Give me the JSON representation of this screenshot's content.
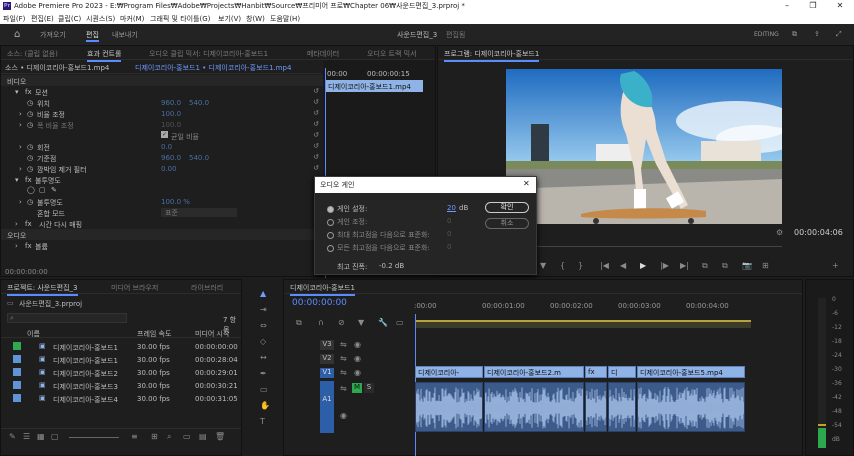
{
  "window": {
    "title": "Adobe Premiere Pro 2023 - E:₩Program Files₩Adobe₩Projects₩Hanbit₩Source₩프리미어 프로₩Chapter 06₩사운드편집_3.prproj *",
    "logo": "Pr"
  },
  "menu": [
    "파일(F)",
    "편집(E)",
    "클립(C)",
    "시퀀스(S)",
    "마커(M)",
    "그래픽 및 타이틀(G)",
    "보기(V)",
    "창(W)",
    "도움말(H)"
  ],
  "header": {
    "workspaces": [
      "가져오기",
      "편집",
      "내보내기"
    ],
    "project_name": "사운드편집_3",
    "project_suffix": "편집됨",
    "editing": "EDITING"
  },
  "effect_controls": {
    "tabs": [
      "소스: (클립 없음)",
      "효과 컨트롤",
      "오디오 클립 믹서: 디제이코리아-홍보드1",
      "메타데이터",
      "오디오 트랙 믹서"
    ],
    "source": "소스 • 디제이코리아-홍보드1.mp4",
    "clip": "디제이코리아-홍보드1 • 디제이코리아-홍보드1.mp4",
    "time_start": "00:00",
    "time_end": "00:00:00:15",
    "timeline_clip": "디제이코리아-홍보드1.mp4",
    "video_header": "비디오",
    "motion": "모션",
    "position": "위치",
    "position_x": "960.0",
    "position_y": "540.0",
    "scale": "비율 조정",
    "scale_val": "100.0",
    "scale_width": "폭 비율 조정",
    "scale_width_val": "100.0",
    "uniform": "균일 비율",
    "rotation": "회전",
    "rotation_val": "0.0",
    "anchor": "기준점",
    "anchor_x": "960.0",
    "anchor_y": "540.0",
    "antiflicker": "깜박임 제거 필터",
    "antiflicker_val": "0.00",
    "opacity": "불투명도",
    "opacity_sub": "불투명도",
    "opacity_val": "100.0 %",
    "blend": "혼합 모드",
    "blend_val": "표준",
    "time_remap": "시간 다시 매핑",
    "audio_header": "오디오",
    "volume": "볼륨",
    "timecode": "00:00:00:00"
  },
  "program": {
    "tab": "프로그램: 디제이코리아-홍보드1",
    "timecode": "00:00:04:06",
    "transport": [
      "▼",
      "{",
      "}",
      "|◀",
      "◀|",
      "◀",
      "▶",
      "|▶",
      "▶|",
      "⧉",
      "⧉",
      "📷",
      "⊞",
      "+"
    ]
  },
  "dialog": {
    "title": "오디오 게인",
    "options": [
      "게인 설정:",
      "게인 조정:",
      "최대 최고점을 다음으로 표준화:",
      "모든 최고점을 다음으로 표준화:"
    ],
    "values": [
      "20",
      "0",
      "0",
      "0"
    ],
    "unit": "dB",
    "ok": "확인",
    "cancel": "취소",
    "peak_label": "최고 진폭:",
    "peak_value": "-0.2 dB"
  },
  "project": {
    "tabs": [
      "프로젝트: 사운드편집_3",
      "미디어 브라우저",
      "라이브러리"
    ],
    "name": "사운드편집_3.prproj",
    "count": "7 항목",
    "columns": [
      "이름",
      "프레임 속도",
      "미디어 시작"
    ],
    "rows": [
      [
        "디제이코리아-홍보드1",
        "30.00 fps",
        "00:00:00:00"
      ],
      [
        "디제이코리아-홍보드1",
        "30.00 fps",
        "00:00:28:04"
      ],
      [
        "디제이코리아-홍보드2",
        "30.00 fps",
        "00:00:29:01"
      ],
      [
        "디제이코리아-홍보드3",
        "30.00 fps",
        "00:00:30:21"
      ],
      [
        "디제이코리아-홍보드4",
        "30.00 fps",
        "00:00:31:05"
      ]
    ],
    "colors": [
      "#2fa84f",
      "#5f95d8",
      "#5f95d8",
      "#5f95d8",
      "#5f95d8"
    ]
  },
  "timeline": {
    "tab": "디제이코리아-홍보드1",
    "timecode": "00:00:00:00",
    "ruler": [
      ":00:00",
      "00:00:01:00",
      "00:00:02:00",
      "00:00:03:00",
      "00:00:04:00"
    ],
    "tracks": [
      "V3",
      "V2",
      "V1",
      "A1"
    ],
    "audio_m": "M",
    "audio_s": "S",
    "clips": [
      "디제이코리아-",
      "디제이코리아-홍보드2.m",
      "디",
      "디제이코리아-홍보드5.mp4"
    ]
  },
  "meter": {
    "labels": [
      "0",
      "-6",
      "-12",
      "-18",
      "-24",
      "-30",
      "-36",
      "-42",
      "-48",
      "-54",
      "dB"
    ]
  },
  "colors": {
    "accent": "#5b8cff",
    "dialog_bg": "#252525",
    "clip_video": "#8fb3e6",
    "clip_audio": "#3c5a8a",
    "meter_green": "#2da84f"
  }
}
